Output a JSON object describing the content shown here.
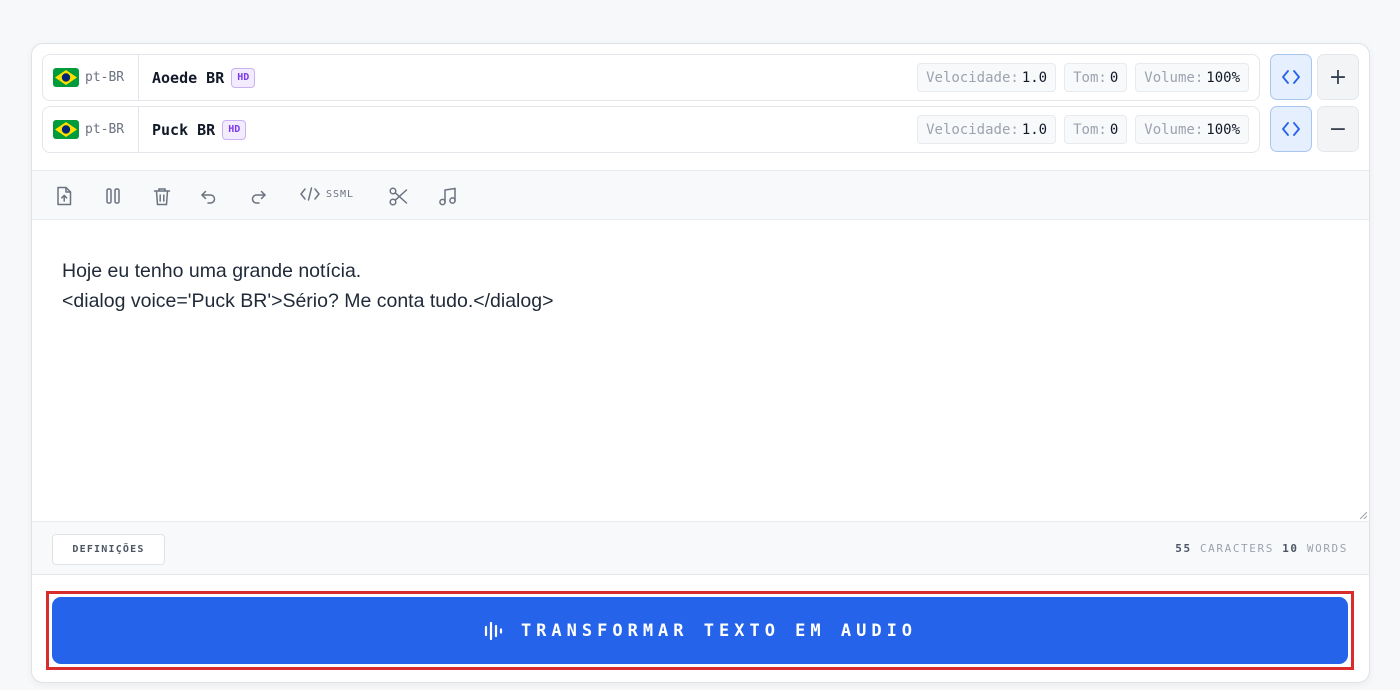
{
  "voices": [
    {
      "lang": "pt-BR",
      "flag_colors": {
        "green": "#009c3b",
        "yellow": "#ffdf00",
        "blue": "#002776"
      },
      "name": "Aoede BR",
      "badge": "HD",
      "speed_label": "Velocidade:",
      "speed_value": "1.0",
      "pitch_label": "Tom:",
      "pitch_value": "0",
      "volume_label": "Volume:",
      "volume_value": "100%",
      "side_action": "+"
    },
    {
      "lang": "pt-BR",
      "flag_colors": {
        "green": "#009c3b",
        "yellow": "#ffdf00",
        "blue": "#002776"
      },
      "name": "Puck BR",
      "badge": "HD",
      "speed_label": "Velocidade:",
      "speed_value": "1.0",
      "pitch_label": "Tom:",
      "pitch_value": "0",
      "volume_label": "Volume:",
      "volume_value": "100%",
      "side_action": "−"
    }
  ],
  "toolbar": {
    "icons": [
      "upload-file-icon",
      "pause-icon",
      "trash-icon",
      "undo-icon",
      "redo-icon",
      "code-icon",
      "scissors-icon",
      "music-note-icon"
    ],
    "ssml_label": "SSML"
  },
  "editor": {
    "lines": [
      "Hoje eu tenho uma grande notícia.",
      "<dialog voice='Puck BR'>Sério? Me conta tudo.</dialog>"
    ]
  },
  "footer": {
    "settings_label": "DEFINIÇÕES",
    "char_count": "55",
    "char_label": "CARACTERS",
    "word_count": "10",
    "word_label": "WORDS"
  },
  "action": {
    "label": "TRANSFORMAR TEXTO EM AUDIO",
    "color": "#2563eb",
    "highlight_color": "#d92d2d"
  }
}
